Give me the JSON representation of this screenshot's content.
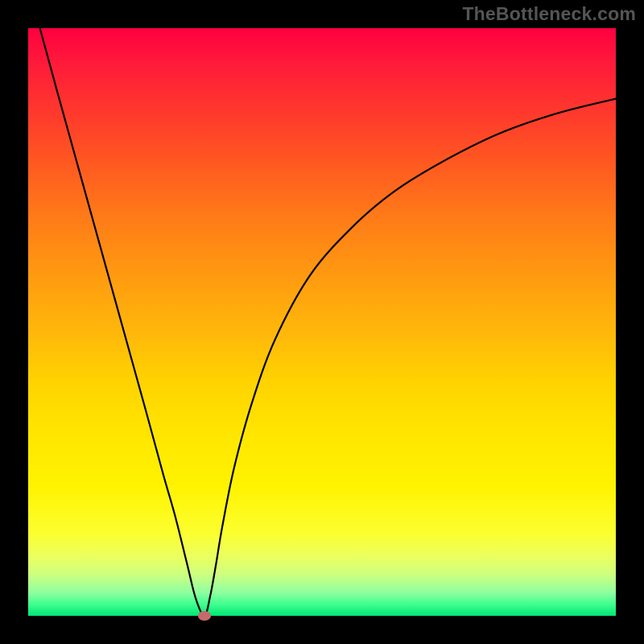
{
  "attribution": "TheBottleneck.com",
  "colors": {
    "frame": "#000000",
    "curve": "#000000",
    "marker": "#c46a6a",
    "gradient_top": "#ff0040",
    "gradient_bottom": "#00e572"
  },
  "chart_data": {
    "type": "line",
    "title": "",
    "xlabel": "",
    "ylabel": "",
    "xlim": [
      0,
      100
    ],
    "ylim": [
      0,
      100
    ],
    "x": [
      2,
      5,
      10,
      15,
      20,
      23,
      25,
      27,
      28.5,
      30,
      31,
      32,
      33,
      35,
      38,
      42,
      48,
      55,
      62,
      70,
      80,
      90,
      100
    ],
    "values": [
      100,
      89,
      71,
      53,
      35,
      24,
      17,
      9,
      3,
      0,
      3.5,
      9,
      15,
      25,
      36,
      47,
      58,
      66,
      72,
      77,
      82,
      85.5,
      88
    ],
    "series": [
      {
        "name": "bottleneck-curve",
        "x_ref": "x",
        "y_ref": "values"
      }
    ],
    "marker": {
      "x": 30,
      "y": 0
    },
    "annotations": [],
    "legend": null,
    "grid": false
  }
}
